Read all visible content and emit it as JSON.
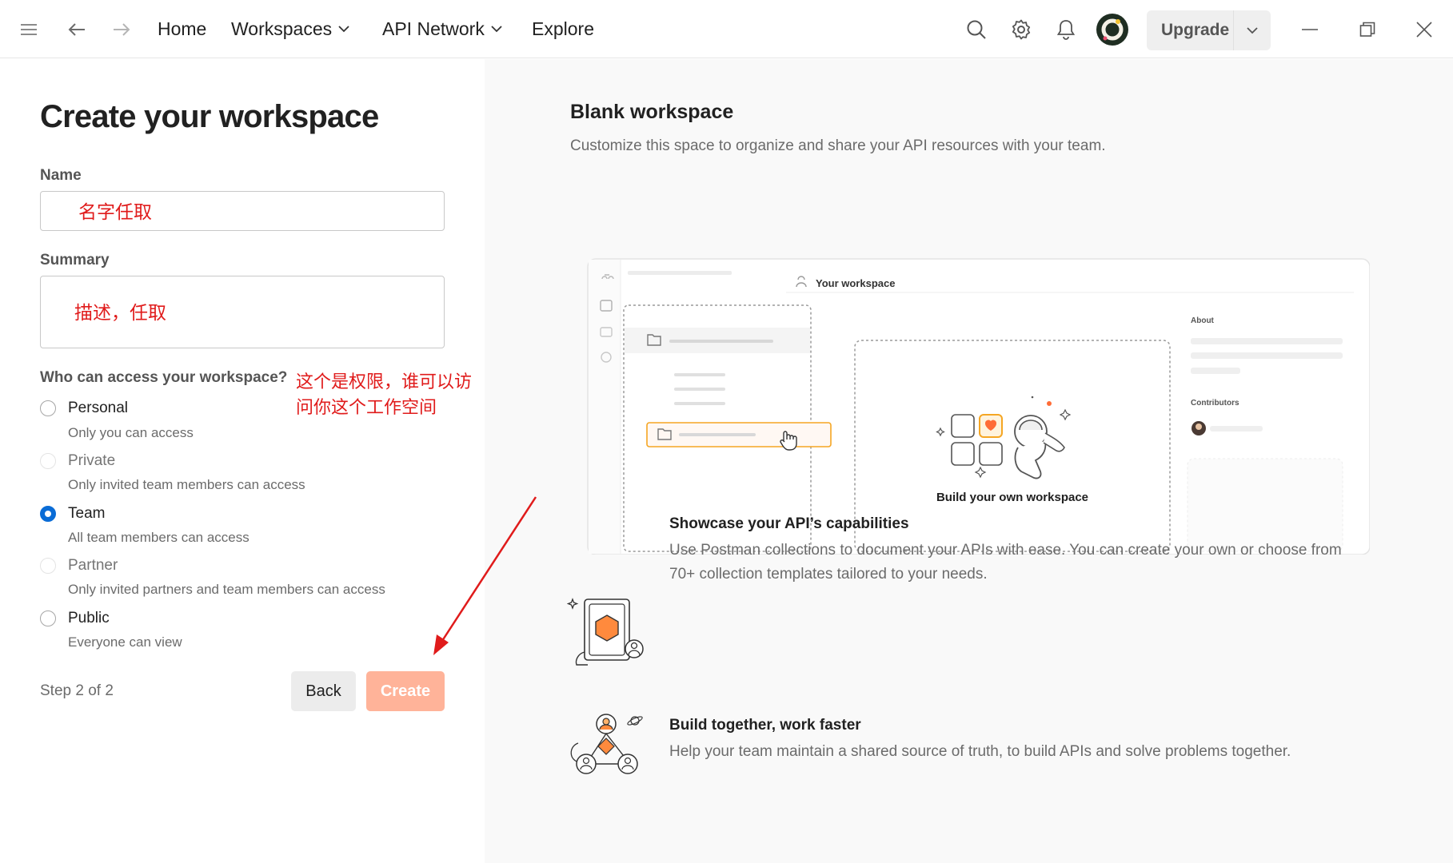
{
  "topbar": {
    "nav": {
      "home": "Home",
      "workspaces": "Workspaces",
      "api_network": "API Network",
      "explore": "Explore"
    },
    "upgrade_label": "Upgrade",
    "icons": [
      "menu-icon",
      "back-arrow-icon",
      "forward-arrow-icon",
      "search-icon",
      "gear-icon",
      "bell-icon",
      "avatar",
      "minimize-icon",
      "restore-icon",
      "close-icon"
    ]
  },
  "form": {
    "title": "Create your workspace",
    "name_label": "Name",
    "name_value": "名字任取",
    "summary_label": "Summary",
    "summary_value": "描述，任取",
    "access_question": "Who can access your workspace?",
    "access_annotation": "这个是权限，谁可以访问你这个工作空间",
    "selected": "Team",
    "options": [
      {
        "label": "Personal",
        "desc": "Only you can access",
        "state": "enabled"
      },
      {
        "label": "Private",
        "desc": "Only invited team members can access",
        "state": "disabled"
      },
      {
        "label": "Team",
        "desc": "All team members can access",
        "state": "checked"
      },
      {
        "label": "Partner",
        "desc": "Only invited partners and team members can access",
        "state": "disabled"
      },
      {
        "label": "Public",
        "desc": "Everyone can view",
        "state": "enabled"
      }
    ],
    "step": "Step 2 of 2",
    "back_label": "Back",
    "create_label": "Create"
  },
  "preview": {
    "title": "Blank workspace",
    "subtitle": "Customize this space to organize and share your API resources with your team.",
    "mock": {
      "header": "Your workspace",
      "about": "About",
      "contributors": "Contributors",
      "build_caption": "Build your own workspace"
    },
    "features": [
      {
        "title": "Showcase your API’s capabilities",
        "desc": "Use Postman collections to document your APIs with ease. You can create your own or choose from 70+ collection templates tailored to your needs."
      },
      {
        "title": "Build together, work faster",
        "desc": "Help your team maintain a shared source of truth, to build APIs and solve problems together."
      }
    ]
  },
  "colors": {
    "accent_blue": "#0a6cd6",
    "create_button": "#ffb399",
    "annotation_red": "#e01b1b",
    "illustration_orange": "#ff6c37",
    "illustration_yellow": "#ffe17a"
  }
}
